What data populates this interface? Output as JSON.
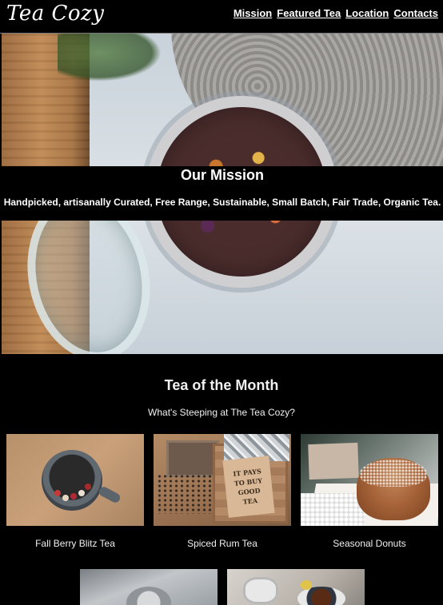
{
  "header": {
    "logo": "Tea Cozy",
    "nav": [
      "Mission",
      "Featured Tea",
      "Location",
      "Contacts"
    ]
  },
  "hero": {
    "title": "Our Mission",
    "text": "Handpicked, artisanally Curated, Free Range, Sustainable, Small Batch, Fair Trade, Organic Tea."
  },
  "tea_of_month": {
    "title": "Tea of the Month",
    "subtitle": "What's Steeping at The Tea Cozy?",
    "items": [
      {
        "label": "Fall Berry Blitz Tea"
      },
      {
        "label": "Spiced Rum Tea"
      },
      {
        "label": "Seasonal Donuts"
      }
    ],
    "sign_text": [
      "IT PAYS",
      "TO BUY",
      "GOOD",
      "TEA"
    ]
  },
  "colors": {
    "background": "#000000",
    "text": "#ffffff",
    "caption": "#f0f0f0",
    "divider": "#7a7a7a"
  }
}
